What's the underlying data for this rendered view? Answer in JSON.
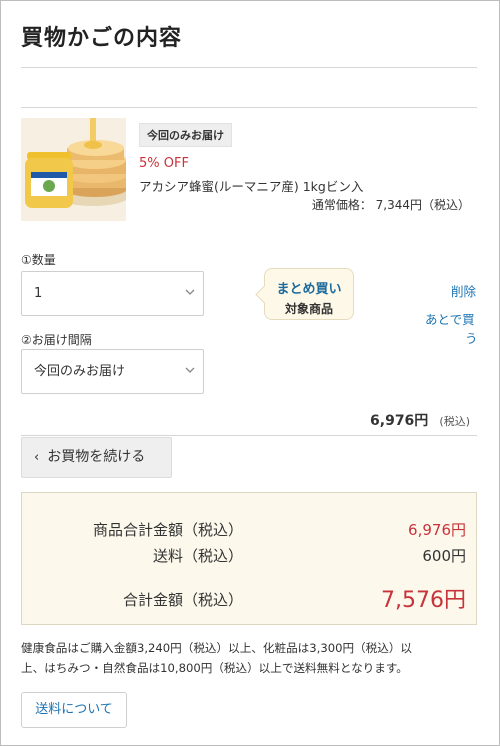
{
  "page": {
    "title": "買物かごの内容"
  },
  "item": {
    "badge": "今回のみお届け",
    "discount": "5% OFF",
    "name": "アカシア蜂蜜(ルーマニア産) 1kgビン入",
    "regular_price": "通常価格： 7,344円（税込）",
    "image_label": "アカシア蜂蜜"
  },
  "quantity": {
    "label": "①数量",
    "value": "1"
  },
  "delivery": {
    "label": "②お届け間隔",
    "value": "今回のみお届け"
  },
  "bulk_tag": {
    "line1": "まとめ買い",
    "line2": "対象商品"
  },
  "actions": {
    "delete": "削除",
    "later_line1": "あとで買",
    "later_line2": "う"
  },
  "subtotal": {
    "amount": "6,976円",
    "tax": "(税込)"
  },
  "continue_button": {
    "arrow": "‹",
    "label": "お買物を続ける"
  },
  "summary": {
    "product_total_label": "商品合計金額（税込）",
    "product_total_value": "6,976円",
    "shipping_label": "送料（税込）",
    "shipping_value": "600円",
    "grand_total_label": "合計金額（税込）",
    "grand_total_value": "7,576円"
  },
  "shipping_note": {
    "line1": "健康食品はご購入金額3,240円（税込）以上、化粧品は3,300円（税込）以",
    "line2": "上、はちみつ・自然食品は10,800円（税込）以上で送料無料となります。"
  },
  "shipping_button": {
    "label": "送料について"
  },
  "colors": {
    "accent_red": "#c8333b",
    "link_blue": "#1d73b0",
    "summary_bg": "#fcf8ec"
  }
}
